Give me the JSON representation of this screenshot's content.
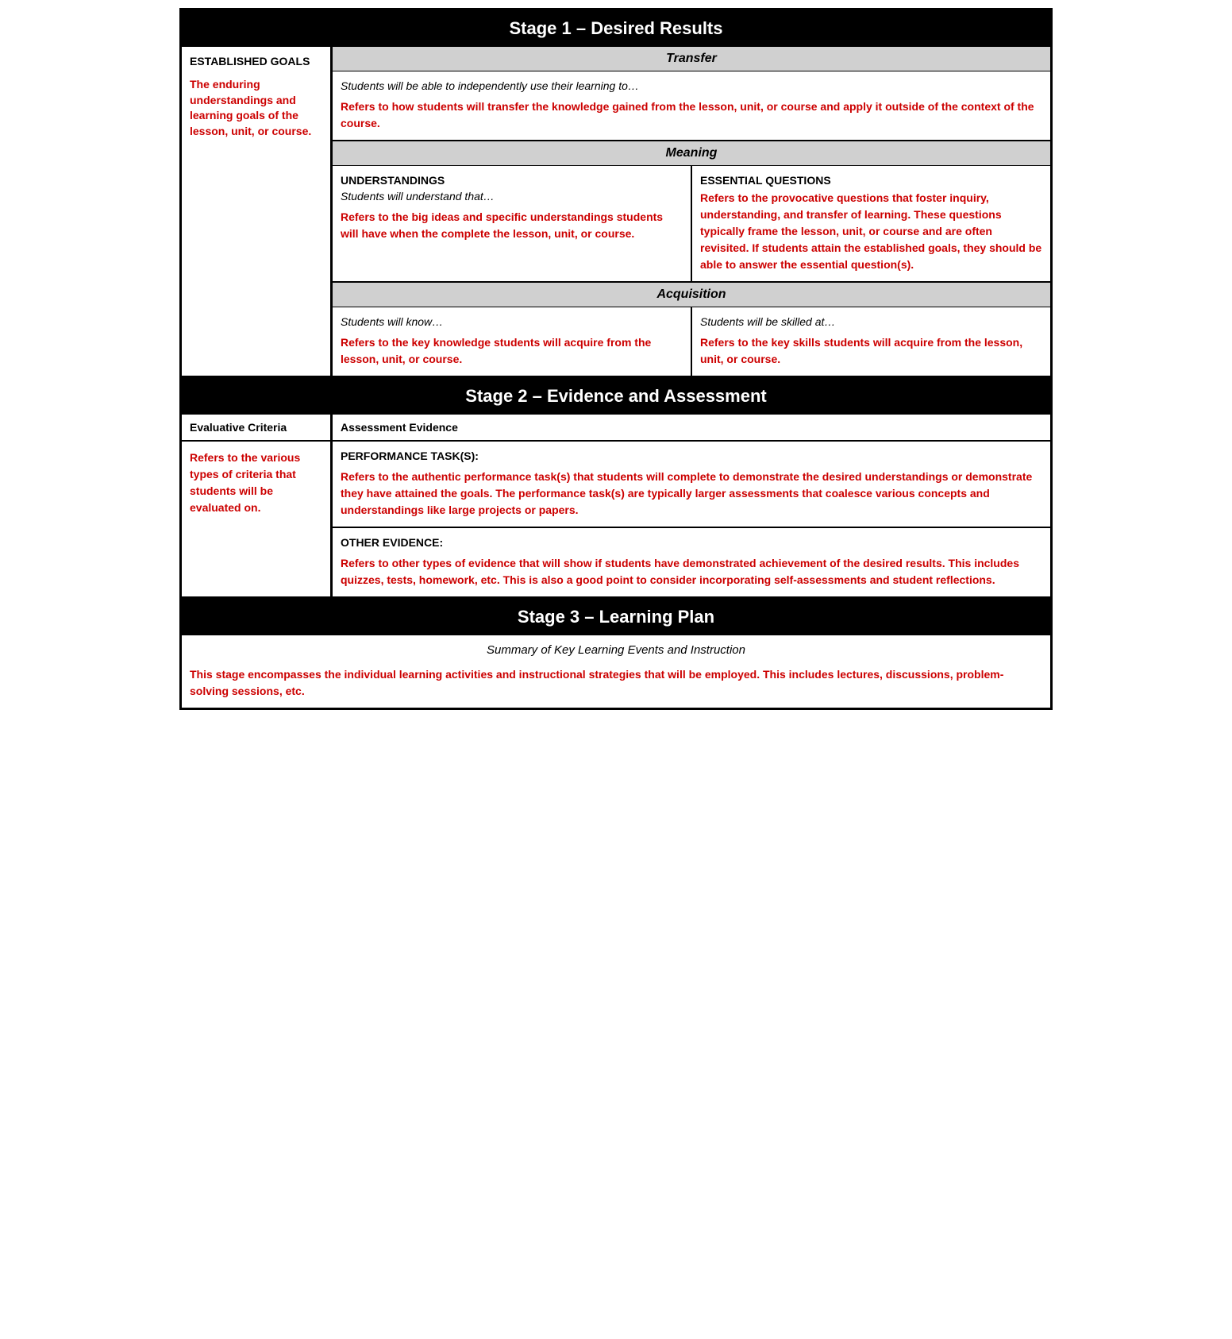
{
  "stage1": {
    "header": "Stage 1 – Desired Results",
    "established_goals": {
      "label": "ESTABLISHED GOALS",
      "description": "The enduring understandings and learning goals of the lesson, unit, or course."
    },
    "transfer": {
      "header": "Transfer",
      "subtitle": "Students will be able to independently use their learning to…",
      "description": "Refers to how students will transfer the knowledge gained from the lesson, unit, or course and apply it outside of the context of the course."
    },
    "meaning": {
      "header": "Meaning",
      "understandings": {
        "label": "UNDERSTANDINGS",
        "subtitle": "Students will understand that…",
        "description": "Refers to the big ideas and specific understandings students will have when the complete the lesson, unit, or course."
      },
      "essential_questions": {
        "label": "ESSENTIAL QUESTIONS",
        "description": "Refers to the provocative questions that foster inquiry, understanding, and transfer of learning. These questions typically frame the lesson, unit, or course and are often revisited. If students attain the established goals, they should be able to answer the essential question(s)."
      }
    },
    "acquisition": {
      "header": "Acquisition",
      "know": {
        "subtitle": "Students will know…",
        "description": "Refers to the key knowledge students will acquire from the lesson, unit, or course."
      },
      "skilled": {
        "subtitle": "Students will be skilled at…",
        "description": "Refers to the key skills students will acquire from the lesson, unit, or course."
      }
    }
  },
  "stage2": {
    "header": "Stage 2 – Evidence and Assessment",
    "evaluative_criteria_label": "Evaluative Criteria",
    "assessment_evidence_label": "Assessment Evidence",
    "evaluative_criteria_text": "Refers to the various types of criteria that students will be evaluated on.",
    "performance_task": {
      "label": "PERFORMANCE TASK(S):",
      "description": "Refers to the authentic performance task(s) that students will complete to demonstrate the desired understandings or demonstrate they have attained the goals. The performance task(s) are typically larger assessments that coalesce various concepts and understandings like large projects or papers."
    },
    "other_evidence": {
      "label": "OTHER EVIDENCE:",
      "description": "Refers to other types of evidence that will show if students have demonstrated achievement of the desired results. This includes quizzes, tests, homework, etc. This is also a good point to consider incorporating self-assessments and student reflections."
    }
  },
  "stage3": {
    "header": "Stage 3 – Learning Plan",
    "subtitle": "Summary of Key Learning Events and Instruction",
    "description": "This stage encompasses the individual learning activities and instructional strategies that will be employed. This includes lectures, discussions, problem-solving sessions, etc."
  }
}
